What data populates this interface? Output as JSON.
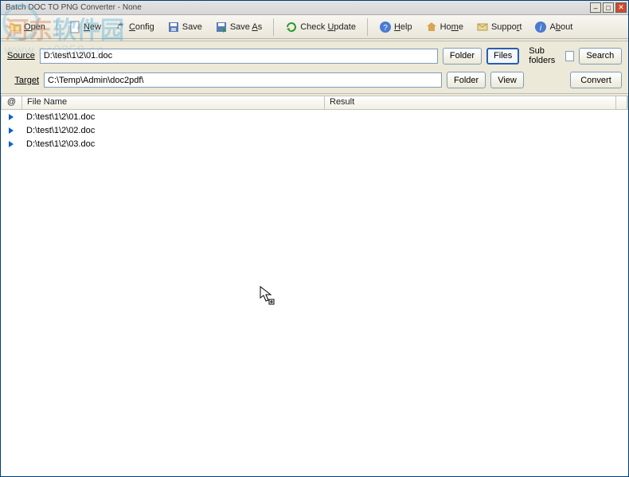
{
  "window": {
    "title": "Batch DOC TO PNG Converter - None"
  },
  "toolbar": {
    "open": "Open",
    "new": "New",
    "config": "Config",
    "save": "Save",
    "saveas": "Save As",
    "check": "Check Update",
    "help": "Help",
    "home": "Home",
    "support": "Support",
    "about": "About"
  },
  "paths": {
    "source_label": "Source",
    "source_value": "D:\\test\\1\\2\\01.doc",
    "target_label": "Target",
    "target_value": "C:\\Temp\\Admin\\doc2pdf\\",
    "folder_btn": "Folder",
    "files_btn": "Files",
    "view_btn": "View",
    "subfolders_label": "Sub folders",
    "search_btn": "Search",
    "convert_btn": "Convert"
  },
  "columns": {
    "at": "@",
    "filename": "File Name",
    "result": "Result"
  },
  "rows": [
    {
      "name": "D:\\test\\1\\2\\01.doc"
    },
    {
      "name": "D:\\test\\1\\2\\02.doc"
    },
    {
      "name": "D:\\test\\1\\2\\03.doc"
    }
  ],
  "watermark": {
    "text1": "河东软件园",
    "text2": "www.pc0359.cn"
  }
}
